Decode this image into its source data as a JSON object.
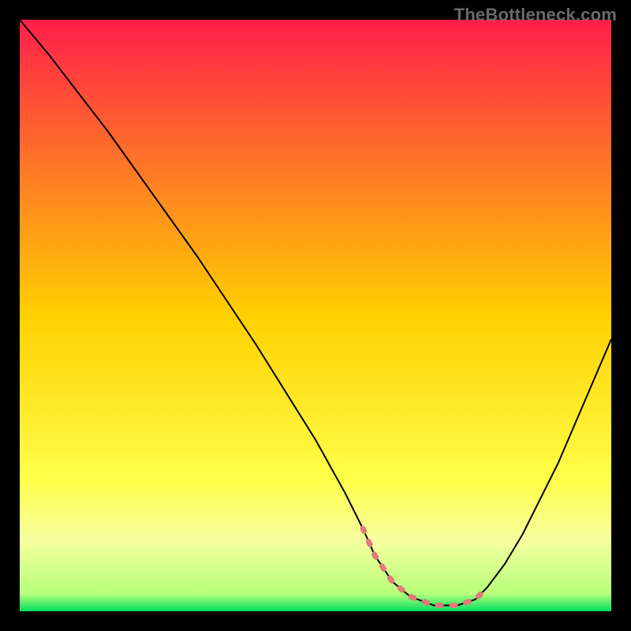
{
  "watermark": "TheBottleneck.com",
  "chart_data": {
    "type": "line",
    "title": "",
    "xlabel": "",
    "ylabel": "",
    "xlim": [
      0,
      100
    ],
    "ylim": [
      0,
      100
    ],
    "grid": false,
    "legend": false,
    "background_gradient": {
      "stops": [
        {
          "offset": 0.0,
          "color": "#ff1f4b"
        },
        {
          "offset": 0.5,
          "color": "#ffd000"
        },
        {
          "offset": 0.78,
          "color": "#ffff4a"
        },
        {
          "offset": 0.88,
          "color": "#f6ffa0"
        },
        {
          "offset": 0.97,
          "color": "#b6ff7a"
        },
        {
          "offset": 1.0,
          "color": "#00e060"
        }
      ]
    },
    "series": [
      {
        "name": "curve",
        "color": "#000000",
        "width": 2,
        "x": [
          0,
          5,
          10,
          15,
          20,
          25,
          30,
          35,
          40,
          45,
          50,
          55,
          58,
          60,
          63,
          66,
          70,
          74,
          77,
          79,
          82,
          85,
          88,
          91,
          94,
          97,
          100
        ],
        "y": [
          100,
          94,
          87.5,
          81,
          74,
          67,
          60,
          52.5,
          45,
          37,
          29,
          20,
          14,
          9.5,
          5,
          2.5,
          1,
          1,
          2,
          4,
          8,
          13,
          19,
          25,
          32,
          39,
          46
        ]
      },
      {
        "name": "highlight-band",
        "color": "#e17a7a",
        "width": 7,
        "x": [
          58,
          60,
          63,
          66,
          70,
          74,
          77,
          79
        ],
        "y": [
          14,
          9.5,
          5,
          2.5,
          1,
          1,
          2,
          4
        ]
      }
    ]
  }
}
